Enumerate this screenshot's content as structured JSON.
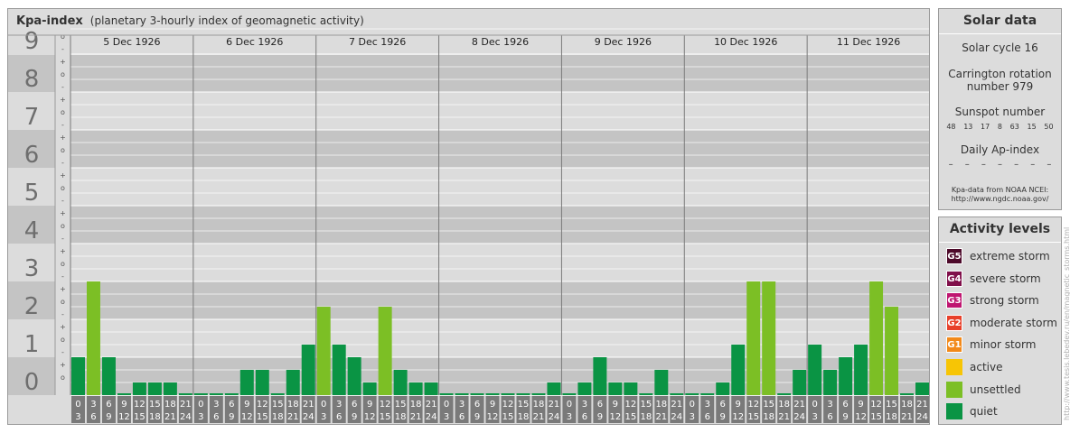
{
  "header": {
    "title": "Kpa-index",
    "subtitle": "(planetary 3-hourly index of geomagnetic activity)"
  },
  "chart_data": {
    "type": "bar",
    "ylim": [
      0,
      9
    ],
    "y_ticks": [
      "0",
      "1",
      "2",
      "3",
      "4",
      "5",
      "6",
      "7",
      "8",
      "9"
    ],
    "minor_tick_labels": [
      "-",
      "o",
      "+"
    ],
    "days": [
      "5 Dec 1926",
      "6 Dec 1926",
      "7 Dec 1926",
      "8 Dec 1926",
      "9 Dec 1926",
      "10 Dec 1926",
      "11 Dec 1926"
    ],
    "interval_start_labels": [
      "0",
      "3",
      "6",
      "9",
      "12",
      "15",
      "18",
      "21"
    ],
    "interval_end_labels": [
      "3",
      "6",
      "9",
      "12",
      "15",
      "18",
      "21",
      "24"
    ],
    "values": [
      [
        1.0,
        3.0,
        1.0,
        0.0,
        0.333,
        0.333,
        0.333,
        0.0
      ],
      [
        0.0,
        0.0,
        0.0,
        0.667,
        0.667,
        0.0,
        0.667,
        1.333
      ],
      [
        2.333,
        1.333,
        1.0,
        0.333,
        2.333,
        0.667,
        0.333,
        0.333
      ],
      [
        0.0,
        0.0,
        0.0,
        0.0,
        0.0,
        0.0,
        0.0,
        0.333
      ],
      [
        0.0,
        0.333,
        1.0,
        0.333,
        0.333,
        0.0,
        0.667,
        0.0
      ],
      [
        0.0,
        0.0,
        0.333,
        1.333,
        3.0,
        3.0,
        0.0,
        0.667
      ],
      [
        1.333,
        0.667,
        1.0,
        1.333,
        3.0,
        2.333,
        0.0,
        0.333
      ]
    ],
    "colors": {
      "quiet": "#0a9444",
      "unsettled": "#7cbf25",
      "band_dark": "#c4c4c4",
      "band_light": "#dcdcdc",
      "tick_box": "#7a7a7a"
    }
  },
  "solar": {
    "title": "Solar data",
    "cycle": "Solar cycle 16",
    "carrington_line1": "Carrington rotation",
    "carrington_line2": "number 979",
    "sunspot_label": "Sunspot number",
    "sunspot_values": [
      "48",
      "13",
      "17",
      "8",
      "63",
      "15",
      "50"
    ],
    "ap_label": "Daily Ap-index",
    "ap_values": [
      "–",
      "–",
      "–",
      "–",
      "–",
      "–",
      "–"
    ],
    "credit_line1": "Kpa-data from NOAA NCEI:",
    "credit_line2": "http://www.ngdc.noaa.gov/"
  },
  "activity": {
    "title": "Activity levels",
    "items": [
      {
        "badge": "G5",
        "label": "extreme storm",
        "color": "#4d0a2a"
      },
      {
        "badge": "G4",
        "label": "severe storm",
        "color": "#800f4a"
      },
      {
        "badge": "G3",
        "label": "strong storm",
        "color": "#bf1570"
      },
      {
        "badge": "G2",
        "label": "moderate storm",
        "color": "#e8402a"
      },
      {
        "badge": "G1",
        "label": "minor storm",
        "color": "#f2891a"
      },
      {
        "badge": "",
        "label": "active",
        "color": "#f7c505"
      },
      {
        "badge": "",
        "label": "unsettled",
        "color": "#7cbf25"
      },
      {
        "badge": "",
        "label": "quiet",
        "color": "#0a9444"
      }
    ]
  },
  "watermark": "http://www.tesis.lebedev.ru/en/magnetic_storms.html"
}
